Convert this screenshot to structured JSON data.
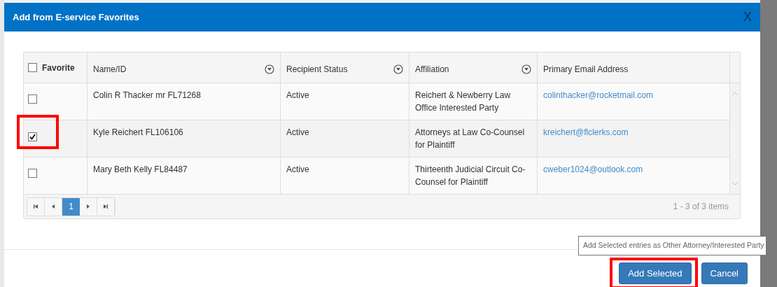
{
  "dialog": {
    "title": "Add from E-service Favorites",
    "close": "X"
  },
  "table": {
    "select_all": {
      "label": "Favorite",
      "checked": false
    },
    "columns": [
      {
        "label": "Name/ID",
        "filter": true
      },
      {
        "label": "Recipient Status",
        "filter": true
      },
      {
        "label": "Affiliation",
        "filter": true
      },
      {
        "label": "Primary Email Address",
        "filter": false
      }
    ],
    "rows": [
      {
        "checked": false,
        "highlighted": false,
        "name": "Colin R Thacker mr FL71268",
        "status": "Active",
        "affiliation": "Reichert & Newberry Law Office Interested Party",
        "email": "colinthacker@rocketmail.com"
      },
      {
        "checked": true,
        "highlighted": true,
        "name": "Kyle Reichert FL106106",
        "status": "Active",
        "affiliation": "Attorneys at Law Co-Counsel for Plaintiff",
        "email": "kreichert@flclerks.com"
      },
      {
        "checked": false,
        "highlighted": false,
        "name": "Mary Beth Kelly FL84487",
        "status": "Active",
        "affiliation": "Thirteenth Judicial Circuit Co-Counsel for Plaintiff",
        "email": "cweber1024@outlook.com"
      }
    ],
    "pager": {
      "pages": [
        {
          "label": "1",
          "selected": true
        }
      ],
      "summary": "1 - 3 of 3 items"
    }
  },
  "tooltip": "Add Selected entries as Other Attorney/Interested Party",
  "buttons": [
    {
      "label": "Add Selected",
      "highlighted": true
    },
    {
      "label": "Cancel",
      "highlighted": false
    }
  ]
}
